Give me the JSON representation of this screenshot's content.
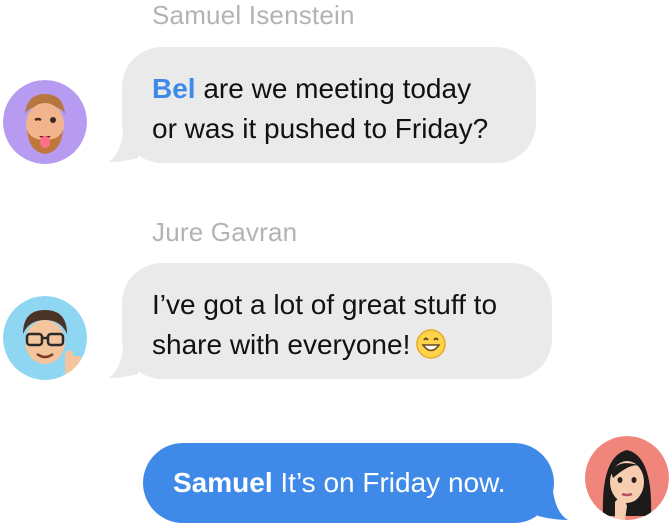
{
  "messages": [
    {
      "sender": "Samuel Isenstein",
      "mention": "Bel",
      "line1_rest": " are we meeting today",
      "line2": "or was it pushed to Friday?",
      "avatar_icon": "memoji-samuel-winking-icon"
    },
    {
      "sender": "Jure Gavran",
      "line1": "I’ve got a lot of great stuff to",
      "line2": "share with everyone!",
      "emoji_icon": "grinning-face-emoji-icon",
      "avatar_icon": "memoji-jure-glasses-thumbs-up-icon"
    },
    {
      "mention": "Samuel",
      "text": " It’s on Friday now.",
      "avatar_icon": "memoji-bel-thinking-icon"
    }
  ],
  "colors": {
    "incoming_bubble": "#eaeaea",
    "outgoing_bubble": "#3f8ae8",
    "mention": "#3f8ae8",
    "sender_name": "#b3b3b3"
  }
}
